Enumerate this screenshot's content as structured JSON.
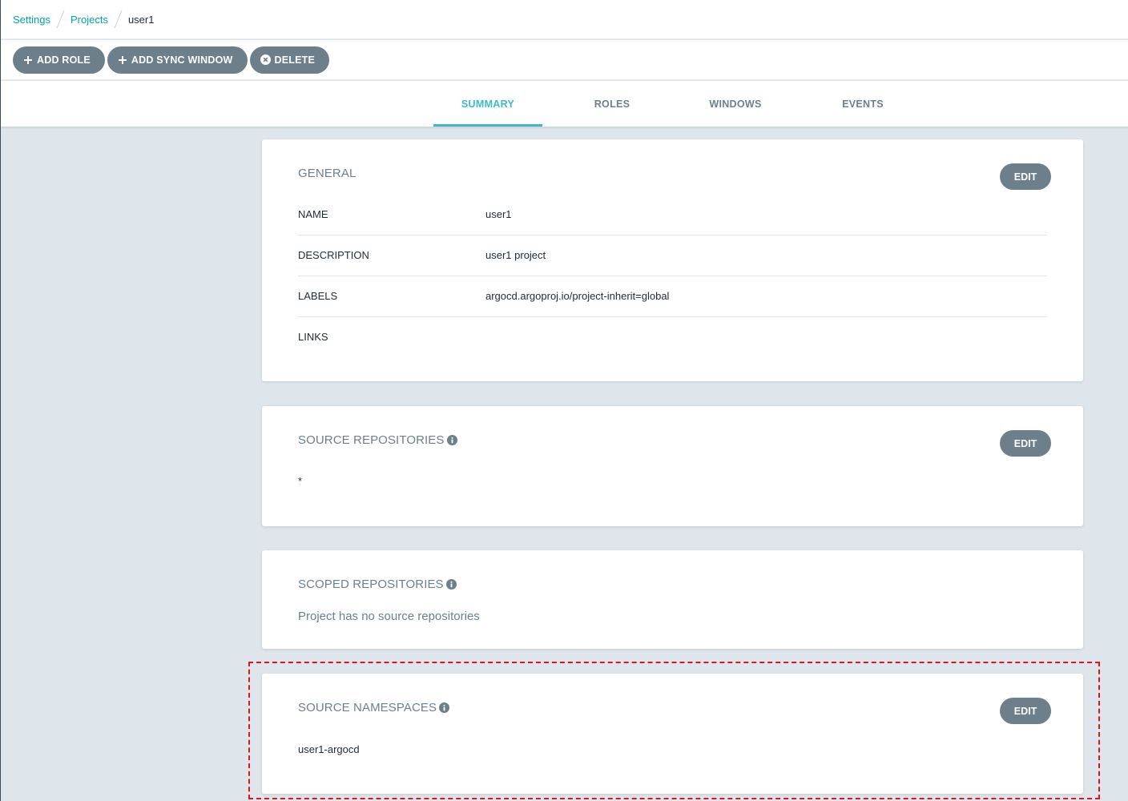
{
  "breadcrumb": {
    "items": [
      "Settings",
      "Projects"
    ],
    "current": "user1"
  },
  "toolbar": {
    "add_role": "ADD ROLE",
    "add_sync_window": "ADD SYNC WINDOW",
    "delete": "DELETE"
  },
  "tabs": [
    "SUMMARY",
    "ROLES",
    "WINDOWS",
    "EVENTS"
  ],
  "active_tab": "SUMMARY",
  "colors": {
    "accent": "#3cb9cb",
    "button": "#6d7f8b",
    "highlight": "#e0141e"
  },
  "general": {
    "title": "GENERAL",
    "edit": "EDIT",
    "rows": [
      {
        "key": "NAME",
        "value": "user1"
      },
      {
        "key": "DESCRIPTION",
        "value": "user1 project"
      },
      {
        "key": "LABELS",
        "value": "argocd.argoproj.io/project-inherit=global"
      },
      {
        "key": "LINKS",
        "value": ""
      }
    ]
  },
  "source_repositories": {
    "title": "SOURCE REPOSITORIES",
    "edit": "EDIT",
    "items": [
      "*"
    ]
  },
  "scoped_repositories": {
    "title": "SCOPED REPOSITORIES",
    "empty_text": "Project has no source repositories"
  },
  "source_namespaces": {
    "title": "SOURCE NAMESPACES",
    "edit": "EDIT",
    "items": [
      "user1-argocd"
    ]
  }
}
